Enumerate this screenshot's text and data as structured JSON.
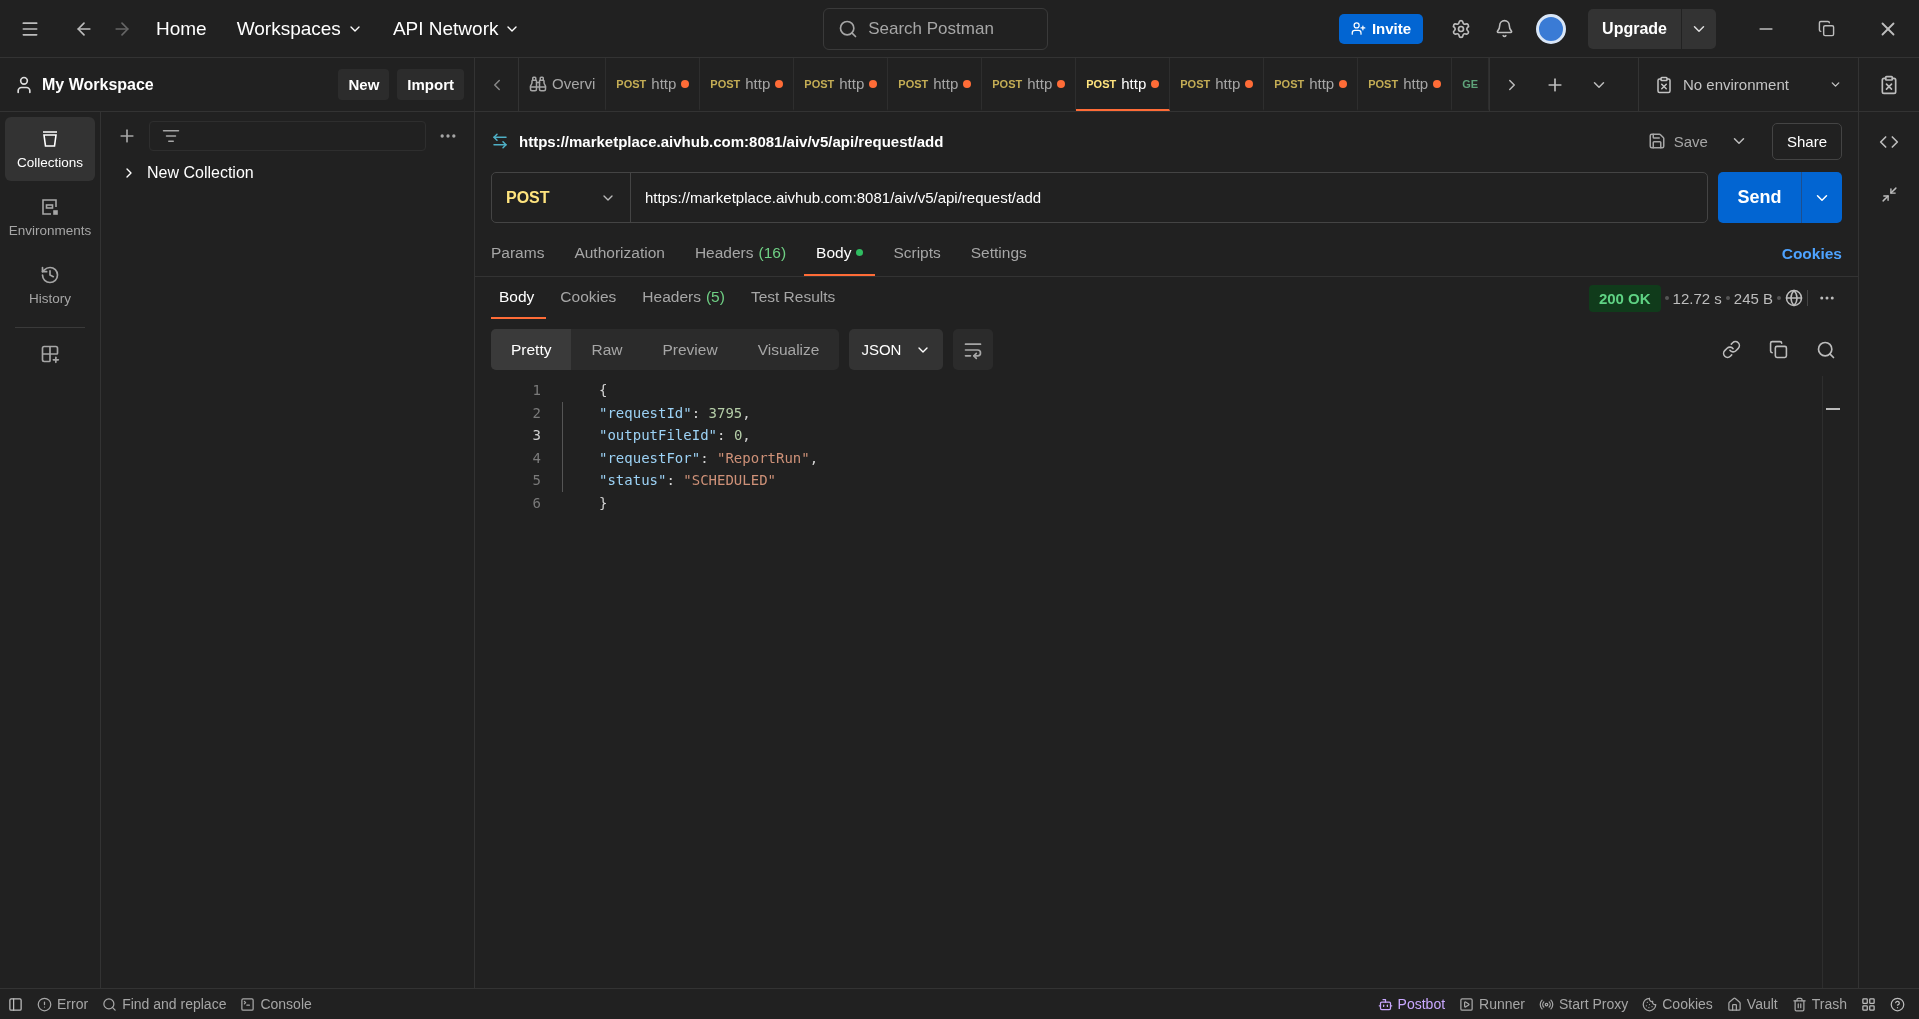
{
  "title_bar": {
    "nav": [
      {
        "label": "Home",
        "dropdown": false
      },
      {
        "label": "Workspaces",
        "dropdown": true
      },
      {
        "label": "API Network",
        "dropdown": true
      }
    ],
    "search": {
      "placeholder": "Search Postman"
    },
    "invite": "Invite",
    "upgrade": "Upgrade"
  },
  "workspace": {
    "name": "My Workspace",
    "buttons": [
      "New",
      "Import"
    ]
  },
  "sidebar": {
    "items": [
      {
        "kind": "collections",
        "label": "Collections",
        "selected": true
      },
      {
        "kind": "environments",
        "label": "Environments",
        "selected": false
      },
      {
        "kind": "history",
        "label": "History",
        "selected": false
      }
    ]
  },
  "collections": [
    {
      "name": "New Collection",
      "expanded": false
    }
  ],
  "tabs": [
    {
      "kind": "overview",
      "label": "Overvi",
      "selected": false,
      "unsaved": false
    },
    {
      "kind": "request",
      "method": "POST",
      "color": "#c4ad55",
      "label": "http",
      "selected": false,
      "unsaved": true
    },
    {
      "kind": "request",
      "method": "POST",
      "color": "#c4ad55",
      "label": "http",
      "selected": false,
      "unsaved": true
    },
    {
      "kind": "request",
      "method": "POST",
      "color": "#c4ad55",
      "label": "http",
      "selected": false,
      "unsaved": true
    },
    {
      "kind": "request",
      "method": "POST",
      "color": "#c4ad55",
      "label": "http",
      "selected": false,
      "unsaved": true
    },
    {
      "kind": "request",
      "method": "POST",
      "color": "#c4ad55",
      "label": "http",
      "selected": false,
      "unsaved": true
    },
    {
      "kind": "request",
      "method": "POST",
      "color": "#ffe47e",
      "label": "http",
      "selected": true,
      "unsaved": true
    },
    {
      "kind": "request",
      "method": "POST",
      "color": "#c4ad55",
      "label": "http",
      "selected": false,
      "unsaved": true
    },
    {
      "kind": "request",
      "method": "POST",
      "color": "#c4ad55",
      "label": "http",
      "selected": false,
      "unsaved": true
    },
    {
      "kind": "request",
      "method": "POST",
      "color": "#c4ad55",
      "label": "http",
      "selected": false,
      "unsaved": true
    },
    {
      "kind": "request",
      "method": "GE",
      "color": "#5fa37a",
      "selected": false,
      "unsaved": false
    }
  ],
  "environment": {
    "label": "No environment"
  },
  "request": {
    "title": "https://marketplace.aivhub.com:8081/aiv/v5/api/request/add",
    "save": "Save",
    "share": "Share",
    "method": "POST",
    "url": "https://marketplace.aivhub.com:8081/aiv/v5/api/request/add",
    "send": "Send"
  },
  "request_tabs": [
    {
      "label": "Params",
      "selected": false,
      "dot": false
    },
    {
      "label": "Authorization",
      "selected": false,
      "dot": false
    },
    {
      "label": "Headers",
      "count": "(16)",
      "selected": false,
      "dot": false
    },
    {
      "label": "Body",
      "selected": true,
      "dot": true
    },
    {
      "label": "Scripts",
      "selected": false,
      "dot": false
    },
    {
      "label": "Settings",
      "selected": false,
      "dot": false
    }
  ],
  "cookies_link": "Cookies",
  "response": {
    "tabs": [
      {
        "label": "Body",
        "selected": true
      },
      {
        "label": "Cookies",
        "selected": false
      },
      {
        "label": "Headers",
        "count": "(5)",
        "selected": false
      },
      {
        "label": "Test Results",
        "selected": false
      }
    ],
    "status": "200 OK",
    "time": "12.72 s",
    "size": "245 B",
    "views": [
      {
        "label": "Pretty",
        "selected": true
      },
      {
        "label": "Raw",
        "selected": false
      },
      {
        "label": "Preview",
        "selected": false
      },
      {
        "label": "Visualize",
        "selected": false
      }
    ],
    "format": "JSON",
    "lines": [
      {
        "number": "1",
        "active": false,
        "indented": false,
        "tokens": [
          {
            "kind": "punct",
            "text": "{"
          }
        ]
      },
      {
        "number": "2",
        "active": false,
        "indented": true,
        "tokens": [
          {
            "kind": "key",
            "text": "\"requestId\""
          },
          {
            "kind": "punct",
            "text": ": "
          },
          {
            "kind": "number",
            "text": "3795"
          },
          {
            "kind": "punct",
            "text": ","
          }
        ]
      },
      {
        "number": "3",
        "active": true,
        "indented": true,
        "tokens": [
          {
            "kind": "key",
            "text": "\"outputFileId\""
          },
          {
            "kind": "punct",
            "text": ": "
          },
          {
            "kind": "number",
            "text": "0"
          },
          {
            "kind": "punct",
            "text": ","
          }
        ]
      },
      {
        "number": "4",
        "active": false,
        "indented": true,
        "tokens": [
          {
            "kind": "key",
            "text": "\"requestFor\""
          },
          {
            "kind": "punct",
            "text": ": "
          },
          {
            "kind": "string",
            "text": "\"ReportRun\""
          },
          {
            "kind": "punct",
            "text": ","
          }
        ]
      },
      {
        "number": "5",
        "active": false,
        "indented": true,
        "tokens": [
          {
            "kind": "key",
            "text": "\"status\""
          },
          {
            "kind": "punct",
            "text": ": "
          },
          {
            "kind": "string",
            "text": "\"SCHEDULED\""
          }
        ]
      },
      {
        "number": "6",
        "active": false,
        "indented": false,
        "tokens": [
          {
            "kind": "punct",
            "text": "}"
          }
        ]
      }
    ]
  },
  "status_bar": {
    "left": [
      {
        "kind": "error",
        "label": "Error",
        "color": "#a6a6a6"
      },
      {
        "kind": "find",
        "label": "Find and replace",
        "color": "#a6a6a6"
      },
      {
        "kind": "console",
        "label": "Console",
        "color": "#a6a6a6"
      }
    ],
    "right": [
      {
        "kind": "postbot",
        "label": "Postbot",
        "color": "#c9a8ff"
      },
      {
        "kind": "runner",
        "label": "Runner",
        "color": "#a6a6a6"
      },
      {
        "kind": "proxy",
        "label": "Start Proxy",
        "color": "#a6a6a6"
      },
      {
        "kind": "cookies",
        "label": "Cookies",
        "color": "#a6a6a6"
      },
      {
        "kind": "vault",
        "label": "Vault",
        "color": "#a6a6a6"
      },
      {
        "kind": "trash",
        "label": "Trash",
        "color": "#a6a6a6"
      }
    ]
  }
}
